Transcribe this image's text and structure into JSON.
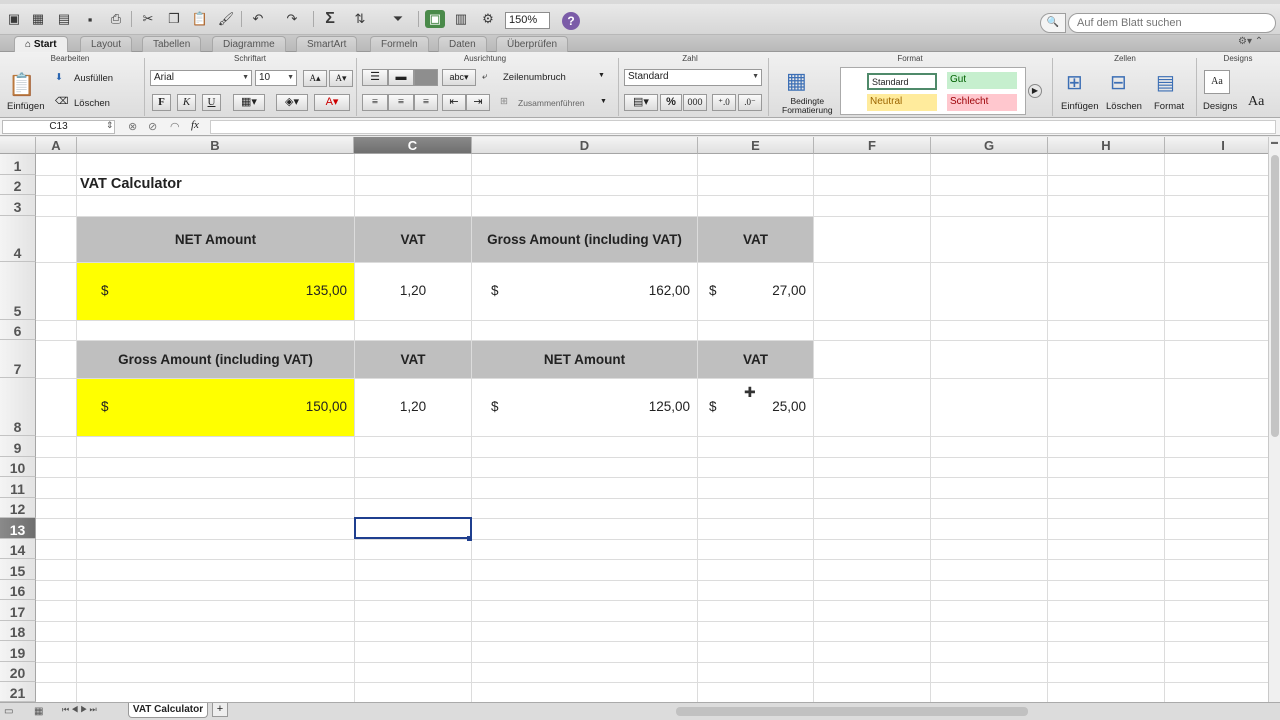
{
  "toolbar": {
    "zoom": "150%",
    "search_placeholder": "Auf dem Blatt suchen",
    "icons": [
      "new-icon",
      "gallery-icon",
      "open-icon",
      "save-icon",
      "print-icon",
      "cut-icon",
      "copy-icon",
      "paste-icon",
      "format-painter-icon",
      "undo-icon",
      "redo-icon",
      "autosum-icon",
      "sort-icon",
      "filter-icon",
      "gallery-toggle-icon",
      "formula-builder-icon",
      "toolbox-icon",
      "help-icon"
    ]
  },
  "ribbon_tabs": [
    "Start",
    "Layout",
    "Tabellen",
    "Diagramme",
    "SmartArt",
    "Formeln",
    "Daten",
    "Überprüfen"
  ],
  "ribbon": {
    "groups": {
      "edit": "Bearbeiten",
      "font": "Schriftart",
      "align": "Ausrichtung",
      "number": "Zahl",
      "format": "Format",
      "cells": "Zellen",
      "themes": "Designs"
    },
    "paste_label": "Einfügen",
    "fill_label": "Ausfüllen",
    "clear_label": "Löschen",
    "font_name": "Arial",
    "font_size": "10",
    "bold": "F",
    "italic": "K",
    "underline": "U",
    "wrap_label": "Zeilenumbruch",
    "merge_label": "Zusammenführen",
    "abc_label": "abc",
    "number_format": "Standard",
    "percent": "%",
    "thousands": "000",
    "cond_format_line1": "Bedingte",
    "cond_format_line2": "Formatierung",
    "styles": {
      "standard": "Standard",
      "good": "Gut",
      "neutral": "Neutral",
      "bad": "Schlecht"
    },
    "insert_label": "Einfügen",
    "delete_label": "Löschen",
    "format_label": "Format",
    "designs_label": "Designs",
    "font_theme": "Aa"
  },
  "formula_bar": {
    "cell_ref": "C13",
    "fx": "fx",
    "content": ""
  },
  "columns": [
    "A",
    "B",
    "C",
    "D",
    "E",
    "F",
    "G",
    "H",
    "I"
  ],
  "rows": [
    "1",
    "2",
    "3",
    "4",
    "5",
    "6",
    "7",
    "8",
    "9",
    "10",
    "11",
    "12",
    "13",
    "14",
    "15",
    "16",
    "17",
    "18",
    "19",
    "20",
    "21"
  ],
  "sheet": {
    "title": "VAT Calculator",
    "table1": {
      "headers": [
        "NET Amount",
        "VAT",
        "Gross Amount (including VAT)",
        "VAT"
      ],
      "currency": "$",
      "net": "135,00",
      "vat_rate": "1,20",
      "gross": "162,00",
      "vat": "27,00"
    },
    "table2": {
      "headers": [
        "Gross Amount (including VAT)",
        "VAT",
        "NET Amount",
        "VAT"
      ],
      "currency": "$",
      "gross": "150,00",
      "vat_rate": "1,20",
      "net": "125,00",
      "vat": "25,00"
    }
  },
  "sheet_tabs": {
    "active": "VAT Calculator",
    "add": "+"
  },
  "colors": {
    "input_fill": "#ffff00",
    "header_fill": "#bfbfbf",
    "selection": "#1f3f8f"
  }
}
